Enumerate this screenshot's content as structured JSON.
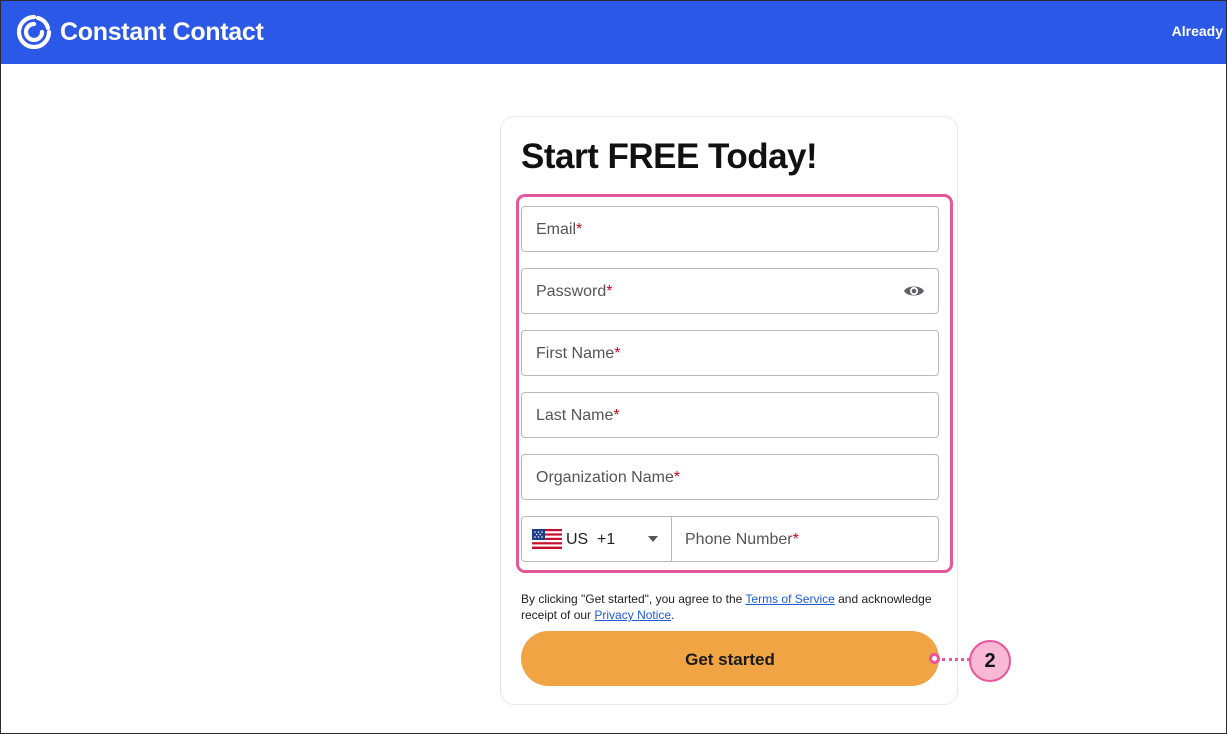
{
  "header": {
    "brand_name": "Constant Contact",
    "signin_text": "Already",
    "background_color": "#2b58e6"
  },
  "form": {
    "title": "Start FREE Today!",
    "required_marker": "*",
    "email": {
      "placeholder": "Email"
    },
    "password": {
      "placeholder": "Password",
      "icon": "eye-icon"
    },
    "first_name": {
      "placeholder": "First Name"
    },
    "last_name": {
      "placeholder": "Last Name"
    },
    "organization": {
      "placeholder": "Organization Name"
    },
    "phone": {
      "country_code": "US",
      "dial_code": "+1",
      "flag_icon": "us-flag-icon",
      "placeholder": "Phone Number"
    },
    "consent": {
      "prefix": "By clicking \"Get started\", you agree to the",
      "terms_link": "Terms of Service",
      "middle": "and acknowledge receipt of our",
      "privacy_link": "Privacy Notice",
      "suffix": "."
    },
    "submit_label": "Get started",
    "submit_color": "#f0a443",
    "highlight_color": "#e7559b"
  },
  "callout": {
    "number": "2"
  }
}
